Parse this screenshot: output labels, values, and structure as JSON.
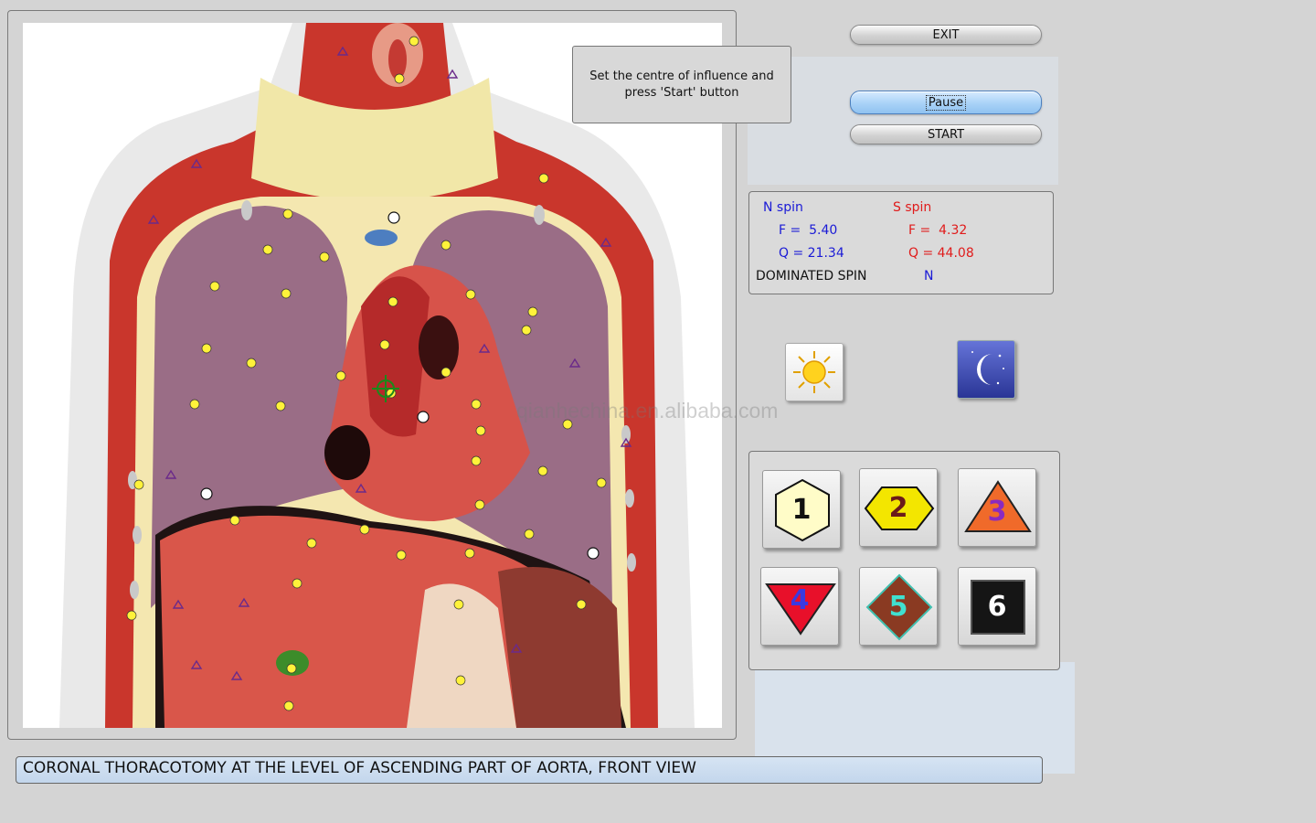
{
  "instruction": "Set the centre of influence and press 'Start' button",
  "buttons": {
    "exit": "EXIT",
    "pause": "Pause",
    "start": "START"
  },
  "spin": {
    "n_label": "N spin",
    "n_f": "F =  5.40",
    "n_q": "Q = 21.34",
    "s_label": "S spin",
    "s_f": "F =  4.32",
    "s_q": "Q = 44.08",
    "dominated_label": "DOMINATED SPIN",
    "dominated_value": "N"
  },
  "mode_icons": [
    "sun-icon",
    "moon-icon"
  ],
  "shapes": [
    {
      "number": "1",
      "shape": "hexagon",
      "fill": "#fffcc8",
      "text_color": "#111111"
    },
    {
      "number": "2",
      "shape": "hexagon-wide",
      "fill": "#f3e600",
      "text_color": "#6b1a1a"
    },
    {
      "number": "3",
      "shape": "triangle-up",
      "fill": "#f06a2a",
      "text_color": "#8a2ac0"
    },
    {
      "number": "4",
      "shape": "triangle-down",
      "fill": "#e8102a",
      "text_color": "#3a3ae0"
    },
    {
      "number": "5",
      "shape": "diamond",
      "fill": "#8a3a22",
      "text_color": "#40e0d0"
    },
    {
      "number": "6",
      "shape": "square",
      "fill": "#151515",
      "text_color": "#ffffff"
    }
  ],
  "caption": "CORONAL THORACOTOMY AT THE LEVEL OF ASCENDING PART OF AORTA, FRONT VIEW",
  "watermark": "qianhechina.en.alibaba.com"
}
